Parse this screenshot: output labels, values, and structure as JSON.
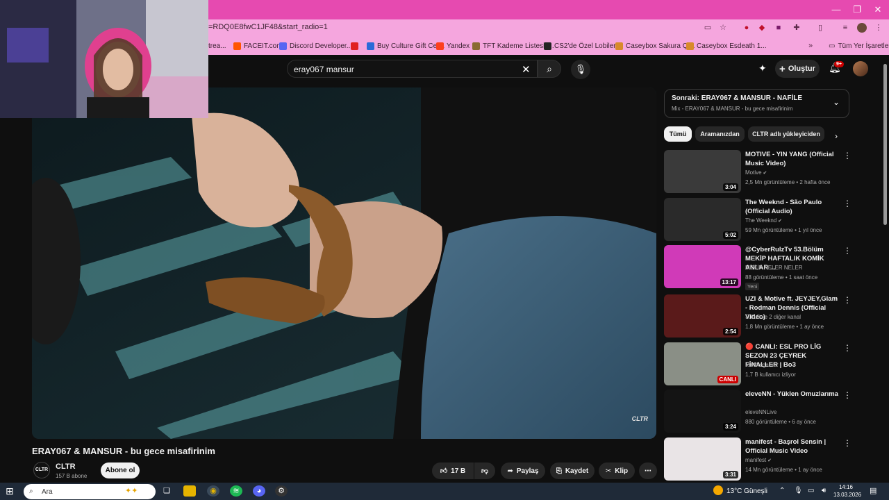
{
  "browser": {
    "url": "=RDQ0E8fwC1JF48&start_radio=1",
    "bookmarks": [
      {
        "label": "trea...",
        "color": "#444444"
      },
      {
        "label": "FACEIT.com",
        "color": "#ff5500"
      },
      {
        "label": "Discord Developer...",
        "color": "#5865f2"
      },
      {
        "label": "",
        "color": "#e02020"
      },
      {
        "label": "Buy Culture Gift Cer...",
        "color": "#2a6ad8"
      },
      {
        "label": "Yandex",
        "color": "#fc3f1d"
      },
      {
        "label": "TFT Kademe Listesi i...",
        "color": "#8a6a30"
      },
      {
        "label": "CS2'de Özel Lobiler...",
        "color": "#222222"
      },
      {
        "label": "Caseybox Sakura Çi...",
        "color": "#d88a2a"
      },
      {
        "label": "Caseybox Esdeath 1...",
        "color": "#d88a2a"
      }
    ],
    "all_bookmarks": "Tüm Yer İşaretleri",
    "window_controls": {
      "minimize": "—",
      "restore": "❐",
      "close": "✕"
    }
  },
  "header": {
    "search_query": "eray067 mansur",
    "create_label": "Oluştur",
    "notif_count": "9+"
  },
  "video": {
    "title": "ERAY067 & MANSUR - bu gece misafirinim",
    "watermark": "CLTR",
    "channel_avatar": "CLTR",
    "channel_name": "CLTR",
    "subscribers": "157 B abone",
    "subscribe_label": "Abone ol",
    "likes": "17 B",
    "share_label": "Paylaş",
    "save_label": "Kaydet",
    "clip_label": "Klip"
  },
  "up_next": {
    "title": "Sonraki: ERAY067 & MANSUR - NAFİLE",
    "subtitle": "Mix - ERAY067 & MANSUR - bu gece misafirinim"
  },
  "chips": [
    "Tümü",
    "Aramanızdan",
    "CLTR adlı yükleyiciden"
  ],
  "recommendations": [
    {
      "title": "MOTIVE - YIN YANG (Official Music Video)",
      "channel": "Motive",
      "verified": true,
      "meta": "2,5 Mn görüntüleme • 2 hafta önce",
      "duration": "3:04",
      "badge": "",
      "live": false,
      "thumb": "#3a3a3a"
    },
    {
      "title": "The Weeknd - São Paulo (Official Audio)",
      "channel": "The Weeknd",
      "verified": true,
      "meta": "59 Mn görüntüleme • 1 yıl önce",
      "duration": "5:02",
      "badge": "",
      "live": false,
      "thumb": "#2a2a2a"
    },
    {
      "title": "@CyberRulzTv 53.Bölüm MEKİP HAFTALIK KOMİK ANLAR ...",
      "channel": "MEKİP NELER NELER",
      "verified": false,
      "meta": "88 görüntüleme • 1 saat önce",
      "duration": "13:17",
      "badge": "Yeni",
      "live": false,
      "thumb": "#d03ab8"
    },
    {
      "title": "UZI & Motive ft. JEYJEY,Glam - Rodman Dennis (Official Video)",
      "channel": "S.O.S ve 2 diğer kanal",
      "verified": false,
      "meta": "1,8 Mn görüntüleme • 1 ay önce",
      "duration": "2:54",
      "badge": "",
      "live": false,
      "thumb": "#5a1a1a"
    },
    {
      "title": "🔴 CANLI: ESL PRO LİG SEZON 23 ÇEYREK FİNALLER | Bo3",
      "channel": "rootthegamer",
      "verified": false,
      "meta": "1,7 B kullanıcı izliyor",
      "duration": "CANLI",
      "badge": "",
      "live": true,
      "thumb": "#8a8f86"
    },
    {
      "title": "eleveNN - Yüklen Omuzlarıma",
      "channel": "eleveNNLive",
      "verified": false,
      "meta": "880 görüntüleme • 6 ay önce",
      "duration": "3:24",
      "badge": "",
      "live": false,
      "thumb": "#141414"
    },
    {
      "title": "manifest - Başrol Sensin | Official Music Video",
      "channel": "manifest",
      "verified": true,
      "meta": "14 Mn görüntüleme • 1 ay önce",
      "duration": "3:31",
      "badge": "",
      "live": false,
      "thumb": "#e9e4e6"
    }
  ],
  "taskbar": {
    "search_placeholder": "Ara",
    "weather": "13°C  Güneşli",
    "time": "14:16",
    "date": "13.03.2026"
  }
}
